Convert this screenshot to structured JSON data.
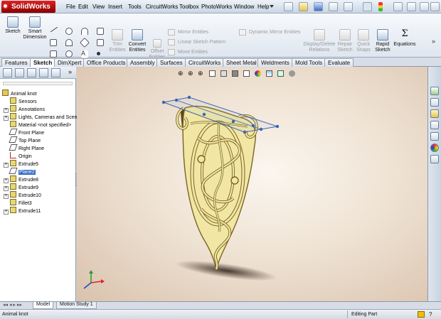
{
  "app": {
    "name": "SolidWorks"
  },
  "menu": [
    "File",
    "Edit",
    "View",
    "Insert",
    "Tools",
    "CircuitWorks",
    "Toolbox",
    "PhotoWorks",
    "Window",
    "Help"
  ],
  "command_manager": {
    "sketch": "Sketch",
    "smart_dimension": [
      "Smart",
      "Dimension"
    ],
    "trim_entities": [
      "Trim",
      "Entities"
    ],
    "convert_entities": [
      "Convert",
      "Entities"
    ],
    "offset_entities": [
      "Offset",
      "Entities"
    ],
    "mirror_entities": "Mirror Entities",
    "linear_sketch_pattern": "Linear Sketch Pattern",
    "move_entities": "Move Entities",
    "dynamic_mirror_entities": "Dynamic Mirror Entities",
    "display_delete_relations": [
      "Display/Delete",
      "Relations"
    ],
    "repair_sketch": [
      "Repair",
      "Sketch"
    ],
    "quick_snaps": [
      "Quick",
      "Snaps"
    ],
    "rapid_sketch": [
      "Rapid",
      "Sketch"
    ],
    "equations": "Equations"
  },
  "tabs": [
    "Features",
    "Sketch",
    "DimXpert",
    "Office Products",
    "Assembly",
    "Surfaces",
    "CircuitWorks",
    "Sheet Metal",
    "Weldments",
    "Mold Tools",
    "Evaluate"
  ],
  "active_tab": "Sketch",
  "feature_tree": {
    "root": "Animal knot",
    "items": [
      {
        "label": "Sensors",
        "icon": "sensor-icon",
        "expandable": false
      },
      {
        "label": "Annotations",
        "icon": "annotations-icon",
        "expandable": true
      },
      {
        "label": "Lights, Cameras and Scene",
        "icon": "lights-icon",
        "expandable": true
      },
      {
        "label": "Material <not specified>",
        "icon": "material-icon",
        "expandable": false
      },
      {
        "label": "Front Plane",
        "icon": "plane-icon",
        "expandable": false
      },
      {
        "label": "Top Plane",
        "icon": "plane-icon",
        "expandable": false
      },
      {
        "label": "Right Plane",
        "icon": "plane-icon",
        "expandable": false
      },
      {
        "label": "Origin",
        "icon": "origin-icon",
        "expandable": false
      },
      {
        "label": "Extrude5",
        "icon": "extrude-icon",
        "expandable": true
      },
      {
        "label": "Plane2",
        "icon": "plane-icon",
        "expandable": false,
        "selected": true
      },
      {
        "label": "Extrude8",
        "icon": "extrude-icon",
        "expandable": true
      },
      {
        "label": "Extrude9",
        "icon": "extrude-icon",
        "expandable": true
      },
      {
        "label": "Extrude10",
        "icon": "extrude-icon",
        "expandable": true
      },
      {
        "label": "Fillet3",
        "icon": "fillet-icon",
        "expandable": false
      },
      {
        "label": "Extrude11",
        "icon": "extrude-icon",
        "expandable": true
      }
    ]
  },
  "bottom_tabs": [
    "Model",
    "Motion Study 1"
  ],
  "status": {
    "left": "Animal knot",
    "right": "Editing Part"
  },
  "colors": {
    "model_fill": "#f2e6a4",
    "model_edge": "#7a6422",
    "selection_blue": "#3a64b4",
    "plane_highlight": "#316ac5"
  }
}
